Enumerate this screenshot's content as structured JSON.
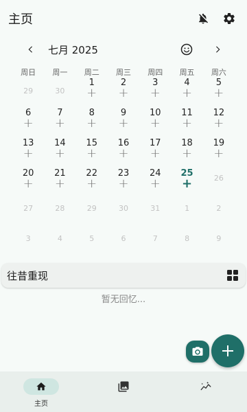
{
  "appbar": {
    "title": "主页",
    "icons": [
      "bell-off-icon",
      "gear-icon"
    ]
  },
  "calendar": {
    "month_label": "七月 2025",
    "weekdays": [
      "周日",
      "周一",
      "周二",
      "周三",
      "周四",
      "周五",
      "周六"
    ],
    "rows": [
      [
        {
          "d": "29",
          "o": true
        },
        {
          "d": "30",
          "o": true
        },
        {
          "d": "1"
        },
        {
          "d": "2"
        },
        {
          "d": "3"
        },
        {
          "d": "4"
        },
        {
          "d": "5"
        }
      ],
      [
        {
          "d": "6"
        },
        {
          "d": "7"
        },
        {
          "d": "8"
        },
        {
          "d": "9"
        },
        {
          "d": "10"
        },
        {
          "d": "11"
        },
        {
          "d": "12"
        }
      ],
      [
        {
          "d": "13"
        },
        {
          "d": "14"
        },
        {
          "d": "15"
        },
        {
          "d": "16"
        },
        {
          "d": "17"
        },
        {
          "d": "18"
        },
        {
          "d": "19"
        }
      ],
      [
        {
          "d": "20"
        },
        {
          "d": "21"
        },
        {
          "d": "22"
        },
        {
          "d": "23"
        },
        {
          "d": "24"
        },
        {
          "d": "25",
          "today": true
        },
        {
          "d": "26",
          "o": true
        }
      ],
      [
        {
          "d": "27",
          "o": true
        },
        {
          "d": "28",
          "o": true
        },
        {
          "d": "29",
          "o": true
        },
        {
          "d": "30",
          "o": true
        },
        {
          "d": "31",
          "o": true
        },
        {
          "d": "1",
          "o": true
        },
        {
          "d": "2",
          "o": true
        }
      ],
      [
        {
          "d": "3",
          "o": true
        },
        {
          "d": "4",
          "o": true
        },
        {
          "d": "5",
          "o": true
        },
        {
          "d": "6",
          "o": true
        },
        {
          "d": "7",
          "o": true
        },
        {
          "d": "8",
          "o": true
        },
        {
          "d": "9",
          "o": true
        }
      ]
    ],
    "add_glyph": "+"
  },
  "memories": {
    "title": "往昔重现",
    "empty_text": "暂无回忆..."
  },
  "bottom_nav": {
    "items": [
      {
        "label": "主页",
        "active": true
      },
      {
        "label": ""
      },
      {
        "label": ""
      }
    ]
  },
  "colors": {
    "accent": "#1f6f68",
    "background": "#f6faf8",
    "nav_bg": "#e9efec"
  }
}
